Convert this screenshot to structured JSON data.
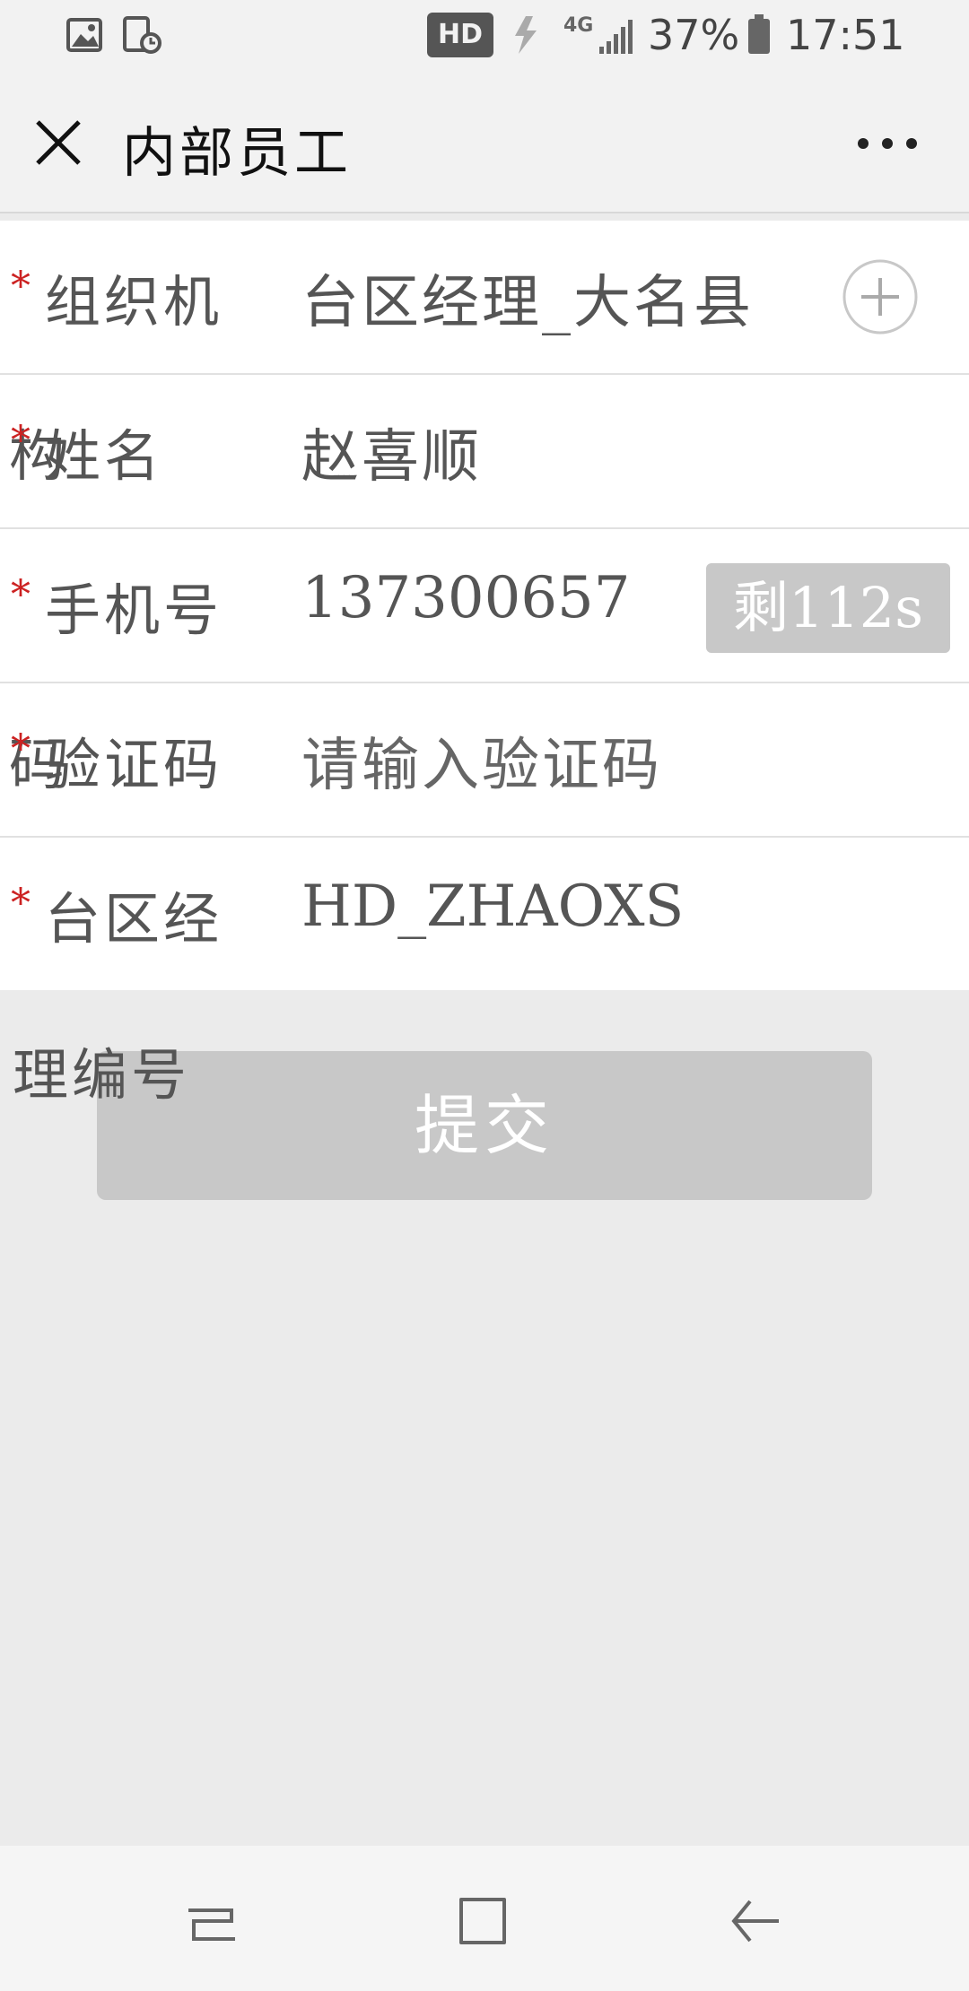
{
  "status_bar": {
    "network": "HD",
    "signal_label": "4G",
    "battery": "37%",
    "time": "17:51"
  },
  "navbar": {
    "title": "内部员工"
  },
  "form": {
    "org": {
      "label": "组织机",
      "value": "台区经理_大名县"
    },
    "name": {
      "label": "姓名",
      "label_overlap": "构",
      "value": "赵喜顺"
    },
    "phone": {
      "label": "手机号",
      "value": "137300657",
      "timer": "剩112s"
    },
    "code": {
      "label": "验证码",
      "label_overlap": "码",
      "placeholder": "请输入验证码"
    },
    "manager": {
      "label": "台区经",
      "label_overflow": "理编号",
      "value": "HD_ZHAOXS"
    },
    "required_mark": "*"
  },
  "submit_label": "提交"
}
